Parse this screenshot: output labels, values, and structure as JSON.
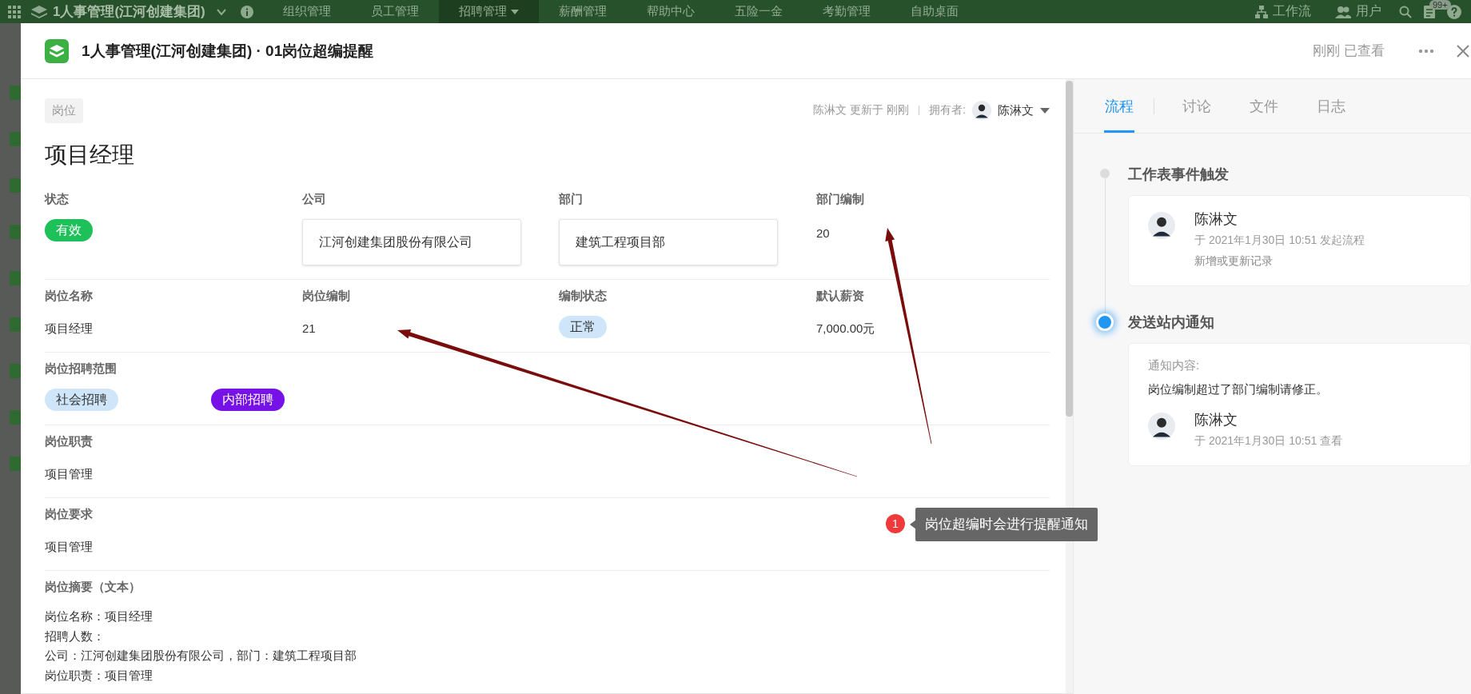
{
  "top_nav": {
    "app_title": "1人事管理(江河创建集团)",
    "items": [
      {
        "label": "组织管理",
        "selected": false,
        "has_menu": false
      },
      {
        "label": "员工管理",
        "selected": false,
        "has_menu": false
      },
      {
        "label": "招聘管理",
        "selected": true,
        "has_menu": true
      },
      {
        "label": "薪酬管理",
        "selected": false,
        "has_menu": false
      },
      {
        "label": "帮助中心",
        "selected": false,
        "has_menu": false
      },
      {
        "label": "五险一金",
        "selected": false,
        "has_menu": false
      },
      {
        "label": "考勤管理",
        "selected": false,
        "has_menu": false
      },
      {
        "label": "自助桌面",
        "selected": false,
        "has_menu": false
      }
    ],
    "workflow_label": "工作流",
    "users_label": "用户",
    "notification_badge": "99+"
  },
  "record": {
    "title": "1人事管理(江河创建集团) · 01岗位超编提醒",
    "view_status": "刚刚 已查看",
    "sheet_tag": "岗位",
    "updated_by": "陈淋文 更新于 刚刚",
    "owner_label": "拥有者:",
    "owner_name": "陈淋文",
    "name": "项目经理",
    "field_rows": [
      [
        {
          "kind": "tags",
          "label": "状态",
          "tags": [
            {
              "label": "有效",
              "color": "#1ec05a"
            }
          ]
        },
        {
          "kind": "box",
          "label": "公司",
          "value": "江河创建集团股份有限公司"
        },
        {
          "kind": "box",
          "label": "部门",
          "value": "建筑工程项目部"
        },
        {
          "kind": "text",
          "label": "部门编制",
          "value": "20"
        }
      ],
      [
        {
          "kind": "text",
          "label": "岗位名称",
          "value": "项目经理"
        },
        {
          "kind": "text",
          "label": "岗位编制",
          "value": "21"
        },
        {
          "kind": "tags",
          "label": "编制状态",
          "tags": [
            {
              "label": "正常",
              "color": "#cfe6fa"
            }
          ]
        },
        {
          "kind": "text",
          "label": "默认薪资",
          "value": "7,000.00元"
        }
      ],
      [
        {
          "kind": "tags",
          "label": "岗位招聘范围",
          "tags": [
            {
              "label": "社会招聘",
              "color": "#cfe6fa"
            },
            {
              "label": "内部招聘",
              "color": "#7612e8"
            }
          ]
        }
      ],
      [
        {
          "kind": "text",
          "label": "岗位职责",
          "value": "项目管理"
        }
      ],
      [
        {
          "kind": "text",
          "label": "岗位要求",
          "value": "项目管理"
        }
      ],
      [
        {
          "kind": "lines",
          "label": "岗位摘要（文本）",
          "lines": [
            "岗位名称：项目经理",
            "招聘人数：",
            "公司：江河创建集团股份有限公司，部门：建筑工程项目部",
            "岗位职责：项目管理"
          ]
        }
      ]
    ]
  },
  "flow": {
    "tabs": [
      {
        "label": "流程",
        "selected": true
      },
      {
        "label": "讨论",
        "selected": false
      },
      {
        "label": "文件",
        "selected": false
      },
      {
        "label": "日志",
        "selected": false
      }
    ],
    "steps": [
      {
        "title": "工作表事件触发",
        "active": false,
        "user_name": "陈淋文",
        "time": "于 2021年1月30日 10:51 发起流程",
        "note": "新增或更新记录"
      },
      {
        "title": "发送站内通知",
        "active": true,
        "content_label": "通知内容:",
        "content": "岗位编制超过了部门编制请修正。",
        "user_name": "陈淋文",
        "time": "于 2021年1月30日 10:51 查看"
      }
    ]
  },
  "annotation": {
    "number": "1",
    "text": "岗位超编时会进行提醒通知"
  }
}
